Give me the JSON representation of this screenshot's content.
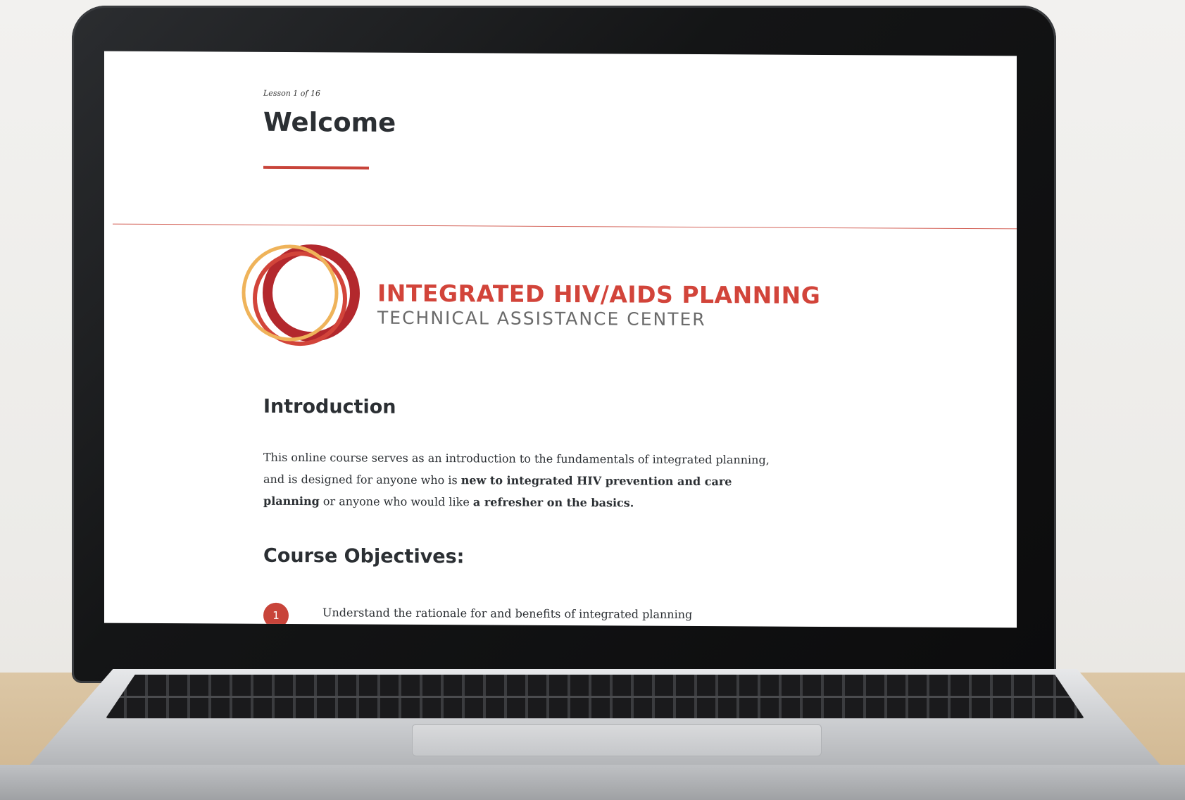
{
  "lesson": {
    "counter": "Lesson 1 of 16",
    "title": "Welcome"
  },
  "logo": {
    "line1": "INTEGRATED  HIV/AIDS PLANNING",
    "line2": "TECHNICAL ASSISTANCE CENTER",
    "colors": {
      "dark_red": "#b3282d",
      "red": "#d2443a",
      "gold": "#efb35a"
    }
  },
  "introduction": {
    "heading": "Introduction",
    "text_1": "This online course serves as an introduction to the fundamentals of integrated planning, and is designed for anyone who is ",
    "bold_1": "new to integrated HIV prevention and care planning",
    "text_2": " or anyone who would like ",
    "bold_2": "a refresher on the basics."
  },
  "objectives": {
    "heading": "Course Objectives:",
    "items": [
      {
        "number": "1",
        "text": "Understand the rationale for and benefits of integrated planning"
      }
    ]
  },
  "theme": {
    "accent": "#c8443a",
    "text": "#2b2f33"
  }
}
